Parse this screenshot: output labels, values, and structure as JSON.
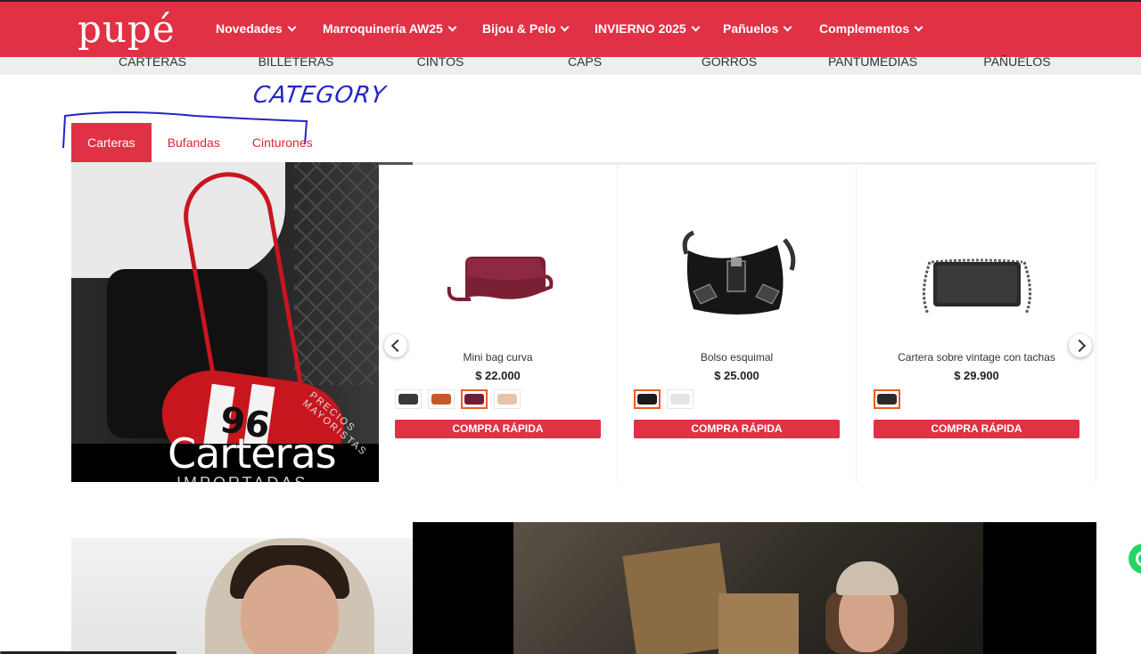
{
  "header": {
    "logo": "pupé",
    "nav": [
      "Novedades",
      "Marroquinería AW25",
      "Bijou & Pelo",
      "INVIERNO 2025",
      "Pañuelos",
      "Complementos"
    ]
  },
  "subnav": [
    "CARTERAS",
    "BILLETERAS",
    "CINTOS",
    "CAPS",
    "GORROS",
    "PANTUMEDIAS",
    "PAÑUELOS"
  ],
  "annotation": {
    "text": "CATEGORY"
  },
  "tabs": [
    {
      "label": "Carteras",
      "active": true
    },
    {
      "label": "Bufandas",
      "active": false
    },
    {
      "label": "Cinturones",
      "active": false
    }
  ],
  "banner": {
    "title": "Carteras",
    "subtitle": "IMPORTADAS",
    "ring_text": "PRECIOS MAYORISTAS",
    "bag_number": "96"
  },
  "products": [
    {
      "name": "Mini bag curva",
      "price": "$ 22.000",
      "buy_label": "COMPRA RÁPIDA",
      "swatches": [
        {
          "color": "#3a3a3a",
          "selected": false
        },
        {
          "color": "#c65a24",
          "selected": false
        },
        {
          "color": "#6e1f35",
          "selected": true
        },
        {
          "color": "#e8c3aa",
          "selected": false
        }
      ]
    },
    {
      "name": "Bolso esquimal",
      "price": "$ 25.000",
      "buy_label": "COMPRA RÁPIDA",
      "swatches": [
        {
          "color": "#1a1a1a",
          "selected": true
        },
        {
          "color": "#e5e5e5",
          "selected": false
        }
      ]
    },
    {
      "name": "Cartera sobre vintage con tachas",
      "price": "$ 29.900",
      "buy_label": "COMPRA RÁPIDA",
      "swatches": [
        {
          "color": "#2a2a2a",
          "selected": true
        }
      ]
    }
  ],
  "colors": {
    "brand": "#e03145",
    "selected_swatch": "#ef5a24",
    "annotation": "#2323c9"
  }
}
